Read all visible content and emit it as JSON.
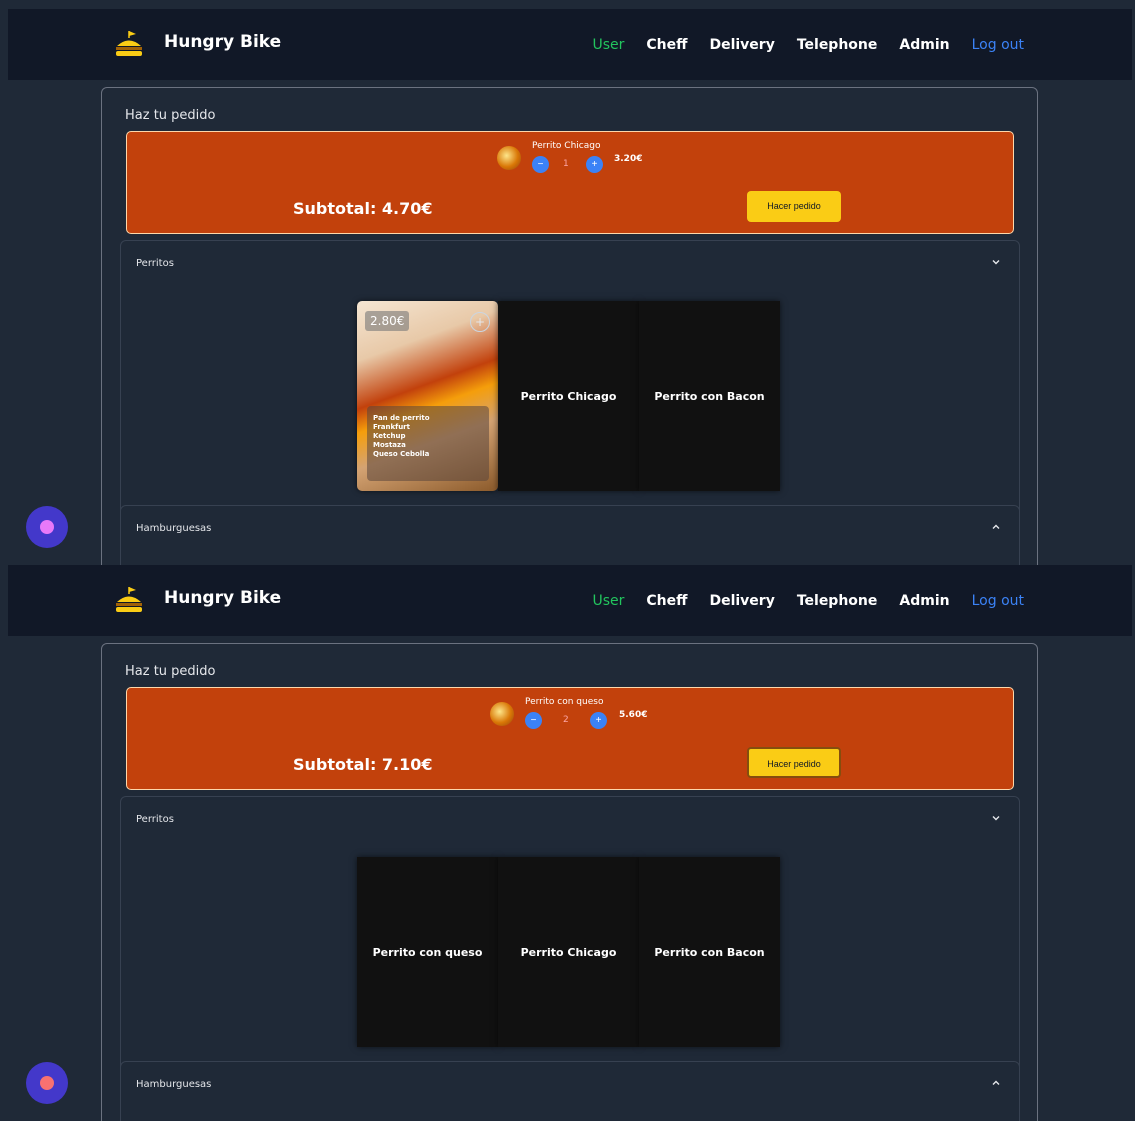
{
  "brand": {
    "name": "Hungry Bike",
    "logo_icon": "burger-bike-icon",
    "logo_color": "#facc15"
  },
  "nav": {
    "user": "User",
    "cheff": "Cheff",
    "delivery": "Delivery",
    "telephone": "Telephone",
    "admin": "Admin",
    "logout": "Log out"
  },
  "colors": {
    "navbar": "#111827",
    "page": "#1f2937",
    "order_box": "#c2410c",
    "order_button": "#facc15",
    "active_link": "#22c55e",
    "logout_link": "#3b82f6",
    "qty_button": "#3b82f6",
    "fab": "#4338ca"
  },
  "screens": [
    {
      "panel_title": "Haz tu pedido",
      "order_item": {
        "name": "Perrito Chicago",
        "quantity": "1",
        "price": "3.20€",
        "minus": "−",
        "plus": "+"
      },
      "subtotal": "Subtotal: 4.70€",
      "order_button": "Hacer pedido",
      "section_perritos": "Perritos",
      "section_hamburguesas": "Hamburguesas",
      "cards": [
        {
          "price": "2.80€",
          "add": "+",
          "ingredients": [
            "Pan de perrito",
            "Frankfurt",
            "Ketchup",
            "Mostaza",
            "Queso Cebolla"
          ]
        },
        {
          "title": "Perrito Chicago"
        },
        {
          "title": "Perrito con Bacon"
        }
      ],
      "fab_dot_color": "#e879f9"
    },
    {
      "panel_title": "Haz tu pedido",
      "order_item": {
        "name": "Perrito con queso",
        "quantity": "2",
        "price": "5.60€",
        "minus": "−",
        "plus": "+"
      },
      "subtotal": "Subtotal: 7.10€",
      "order_button": "Hacer pedido",
      "section_perritos": "Perritos",
      "section_hamburguesas": "Hamburguesas",
      "cards": [
        {
          "title": "Perrito con queso"
        },
        {
          "title": "Perrito Chicago"
        },
        {
          "title": "Perrito con Bacon"
        }
      ],
      "fab_dot_color": "#f87171"
    }
  ]
}
